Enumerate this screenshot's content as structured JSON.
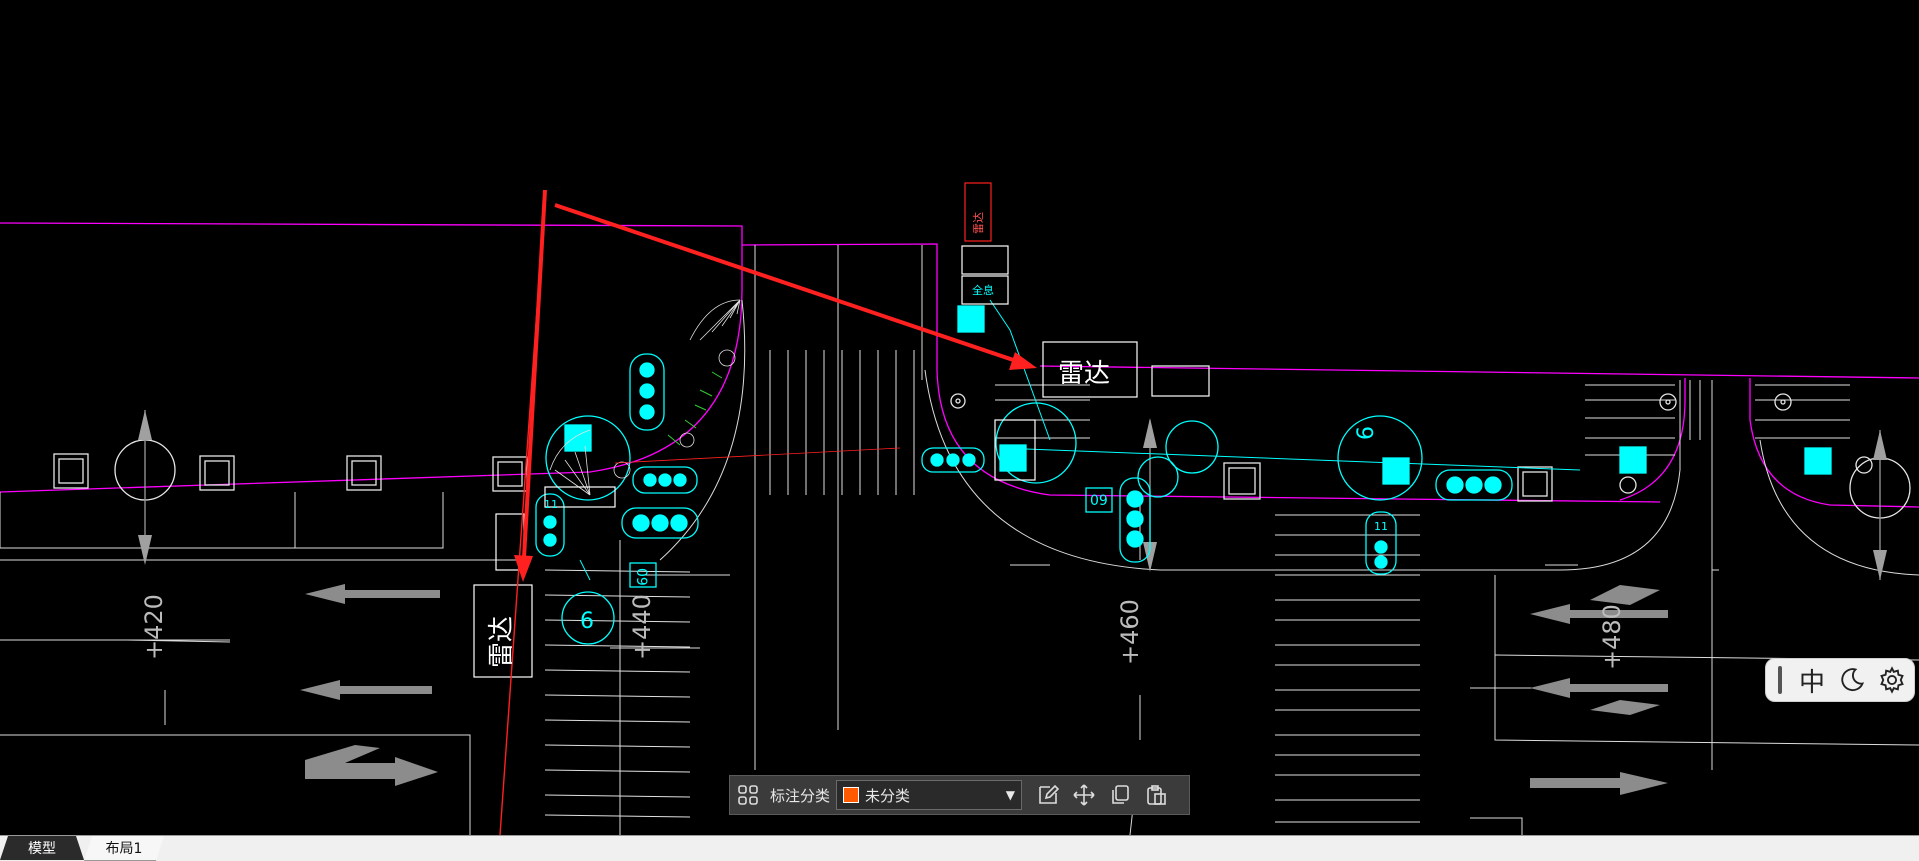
{
  "drawing": {
    "labels": {
      "radar_vertical": "雷达",
      "radar_horizontal": "雷达",
      "sign_60_a": "09",
      "sign_60_b": "09",
      "station_420": "+420",
      "station_440": "+440",
      "station_460": "+460",
      "station_480": "+480",
      "circle_6": "6",
      "circle_6b": "6",
      "signal_11_a": "11",
      "signal_11_b": "11",
      "red_box_text": "雷达",
      "small_box_text": "全息"
    },
    "colors": {
      "road_edge": "#ff00ff",
      "equipment": "#00ffff",
      "arrow": "#ff2020",
      "lines": "#ffffff",
      "lane_arrows": "#8c8c8c"
    }
  },
  "annotation_toolbar": {
    "label": "标注分类",
    "category_value": "未分类",
    "category_color": "#ff5a00",
    "icons": [
      "grid-icon",
      "edit-icon",
      "move-icon",
      "copy-icon",
      "paste-icon"
    ]
  },
  "side_toolbar": {
    "lang": "中",
    "icons": [
      "moon-icon",
      "gear-icon"
    ]
  },
  "tabs": [
    {
      "label": "模型"
    },
    {
      "label": "布局1"
    }
  ]
}
